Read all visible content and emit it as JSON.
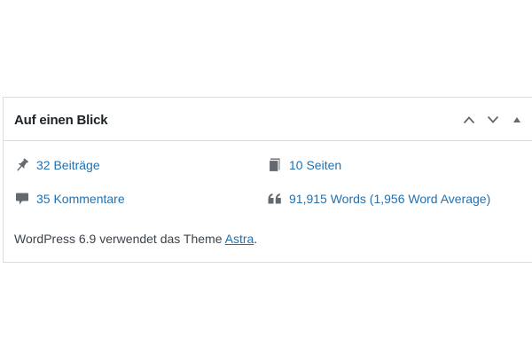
{
  "widget": {
    "title": "Auf einen Blick",
    "controls": {
      "move_up_icon": "chevron-up-icon",
      "move_down_icon": "chevron-down-icon",
      "toggle_icon": "triangle-up-icon"
    },
    "stats": [
      {
        "icon": "pushpin-icon",
        "label": "32 Beiträge"
      },
      {
        "icon": "pages-icon",
        "label": "10 Seiten"
      },
      {
        "icon": "comment-icon",
        "label": "35 Kommentare"
      },
      {
        "icon": "quote-icon",
        "label": "91,915 Words (1,956 Word Average)"
      }
    ],
    "footer": {
      "text_before": "WordPress 6.9 verwendet das Theme ",
      "theme_link": "Astra",
      "text_after": "."
    }
  },
  "colors": {
    "link": "#2271b1",
    "icon": "#646970",
    "border": "#dcdcde",
    "text": "#1d2327"
  }
}
